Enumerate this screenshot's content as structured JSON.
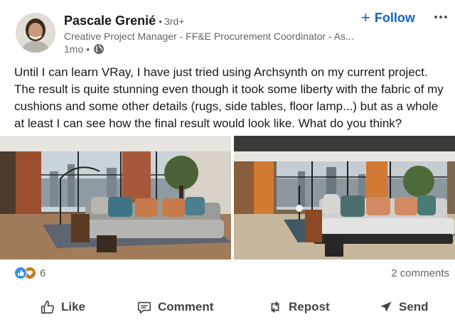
{
  "author": {
    "name": "Pascale Grenié",
    "degree": "3rd+",
    "headline": "Creative Project Manager - FF&E Procurement Coordinator - As...",
    "time": "1mo"
  },
  "header": {
    "follow_label": "Follow"
  },
  "post": {
    "text": "Until I can learn VRay, I have just tried using Archsynth on my current project. The result is quite stunning even though it took some liberty with the fabric of my cushions and some other details (rugs, side tables, floor lamp...) but as a whole at least I can see how the final result would look like. What do you think?"
  },
  "social": {
    "reaction_count": "6",
    "comments_label": "2 comments",
    "colors": {
      "like": "#378fe9",
      "love": "#c37d16"
    }
  },
  "actions": {
    "like": "Like",
    "comment": "Comment",
    "repost": "Repost",
    "send": "Send"
  },
  "icons": [
    "globe-icon",
    "more-icon",
    "like-reaction-icon",
    "love-reaction-icon",
    "thumbs-up-icon",
    "comment-icon",
    "repost-icon",
    "send-icon"
  ],
  "theme": {
    "accent": "#0a66c2",
    "text": "#191919",
    "muted": "#666666"
  }
}
